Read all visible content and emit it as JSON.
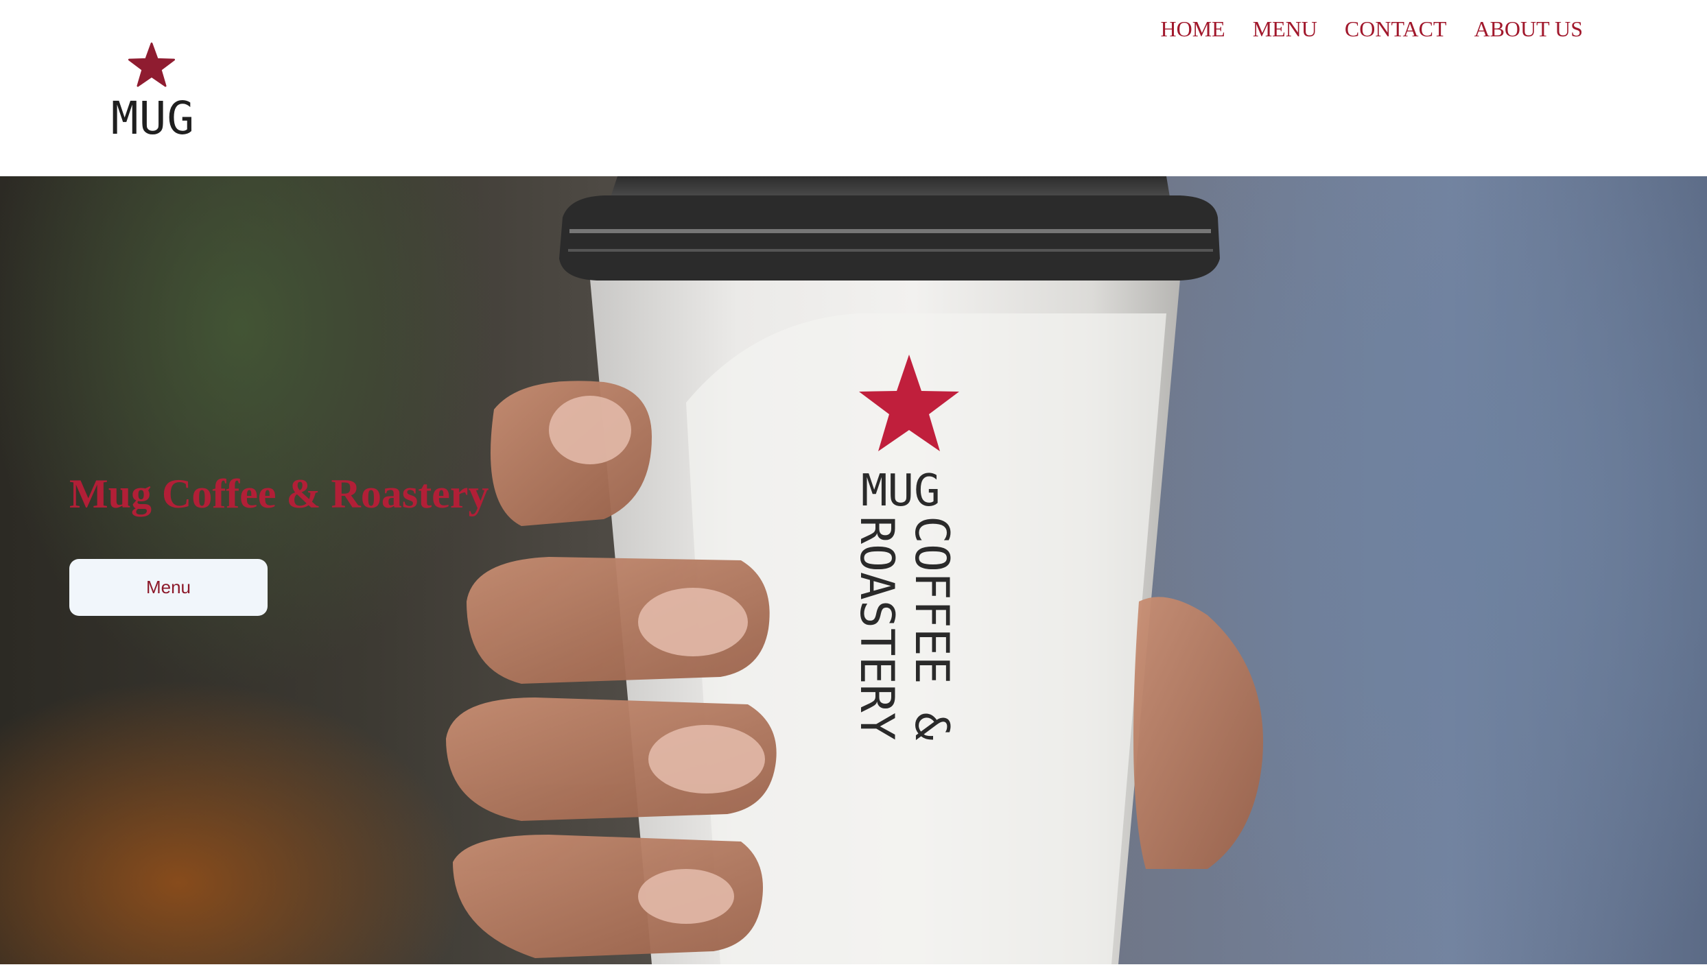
{
  "logo": {
    "text": "MUG",
    "icon": "star-icon",
    "color": "#8f1c30"
  },
  "nav": {
    "items": [
      {
        "label": "HOME"
      },
      {
        "label": "MENU"
      },
      {
        "label": "CONTACT"
      },
      {
        "label": "ABOUT US"
      }
    ],
    "color": "#a1182c"
  },
  "hero": {
    "title": "Mug Coffee & Roastery",
    "button_label": "Menu",
    "cup_print": {
      "line1": "MUG",
      "line2": "COFFEE &",
      "line3": "ROASTERY",
      "icon": "star-icon"
    },
    "accent": "#b21f37"
  }
}
